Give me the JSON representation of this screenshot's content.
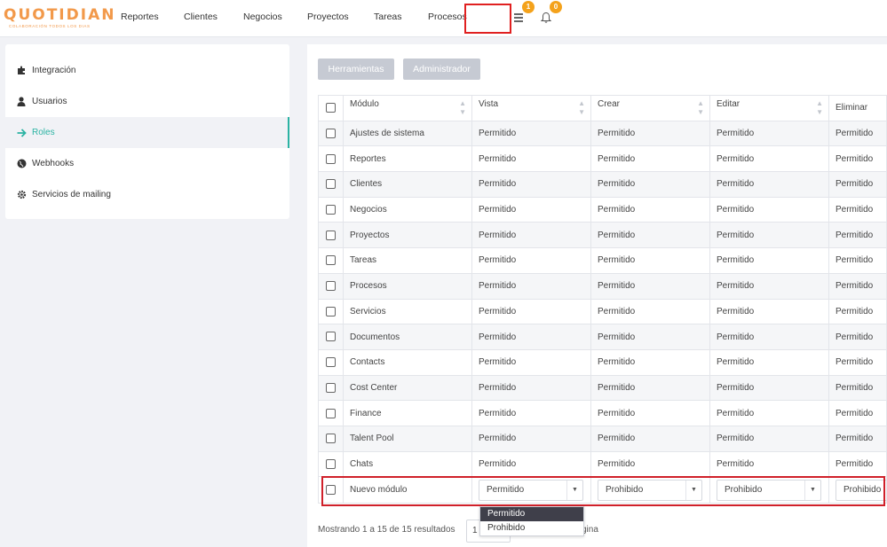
{
  "brand": {
    "logo": "QUOTIDIAN",
    "tagline": "COLABORACIÓN TODOS LOS DIAS",
    "color": "#f2994a"
  },
  "nav": {
    "items": [
      "Reportes",
      "Clientes",
      "Negocios",
      "Proyectos",
      "Tareas",
      "Procesos"
    ],
    "list_badge": "1",
    "bell_badge": "0"
  },
  "sidebar": {
    "items": [
      {
        "label": "Integración",
        "icon": "puzzle-icon"
      },
      {
        "label": "Usuarios",
        "icon": "user-icon"
      },
      {
        "label": "Roles",
        "icon": "arrow-right-icon",
        "active": true
      },
      {
        "label": "Webhooks",
        "icon": "globe-icon"
      },
      {
        "label": "Servicios de mailing",
        "icon": "gear-icon"
      }
    ],
    "accent": "#2bb3a3"
  },
  "toolbar": {
    "tools_label": "Herramientas",
    "admin_label": "Administrador"
  },
  "table": {
    "columns": [
      "Módulo",
      "Vista",
      "Crear",
      "Editar",
      "Eliminar"
    ],
    "rows": [
      [
        "Ajustes de sistema",
        "Permitido",
        "Permitido",
        "Permitido",
        "Permitido"
      ],
      [
        "Reportes",
        "Permitido",
        "Permitido",
        "Permitido",
        "Permitido"
      ],
      [
        "Clientes",
        "Permitido",
        "Permitido",
        "Permitido",
        "Permitido"
      ],
      [
        "Negocios",
        "Permitido",
        "Permitido",
        "Permitido",
        "Permitido"
      ],
      [
        "Proyectos",
        "Permitido",
        "Permitido",
        "Permitido",
        "Permitido"
      ],
      [
        "Tareas",
        "Permitido",
        "Permitido",
        "Permitido",
        "Permitido"
      ],
      [
        "Procesos",
        "Permitido",
        "Permitido",
        "Permitido",
        "Permitido"
      ],
      [
        "Servicios",
        "Permitido",
        "Permitido",
        "Permitido",
        "Permitido"
      ],
      [
        "Documentos",
        "Permitido",
        "Permitido",
        "Permitido",
        "Permitido"
      ],
      [
        "Contacts",
        "Permitido",
        "Permitido",
        "Permitido",
        "Permitido"
      ],
      [
        "Cost Center",
        "Permitido",
        "Permitido",
        "Permitido",
        "Permitido"
      ],
      [
        "Finance",
        "Permitido",
        "Permitido",
        "Permitido",
        "Permitido"
      ],
      [
        "Talent Pool",
        "Permitido",
        "Permitido",
        "Permitido",
        "Permitido"
      ],
      [
        "Chats",
        "Permitido",
        "Permitido",
        "Permitido",
        "Permitido"
      ]
    ],
    "new_row": {
      "module": "Nuevo módulo",
      "vista": "Permitido",
      "crear": "Prohibido",
      "editar": "Prohibido",
      "eliminar": "Prohibido"
    }
  },
  "dropdown": {
    "options": [
      "Permitido",
      "Prohibido"
    ],
    "selected": "Permitido"
  },
  "footer": {
    "results_text": "Mostrando 1 a 15 de 15 resultados",
    "page_value": "1",
    "per_page_suffix": "gina"
  }
}
